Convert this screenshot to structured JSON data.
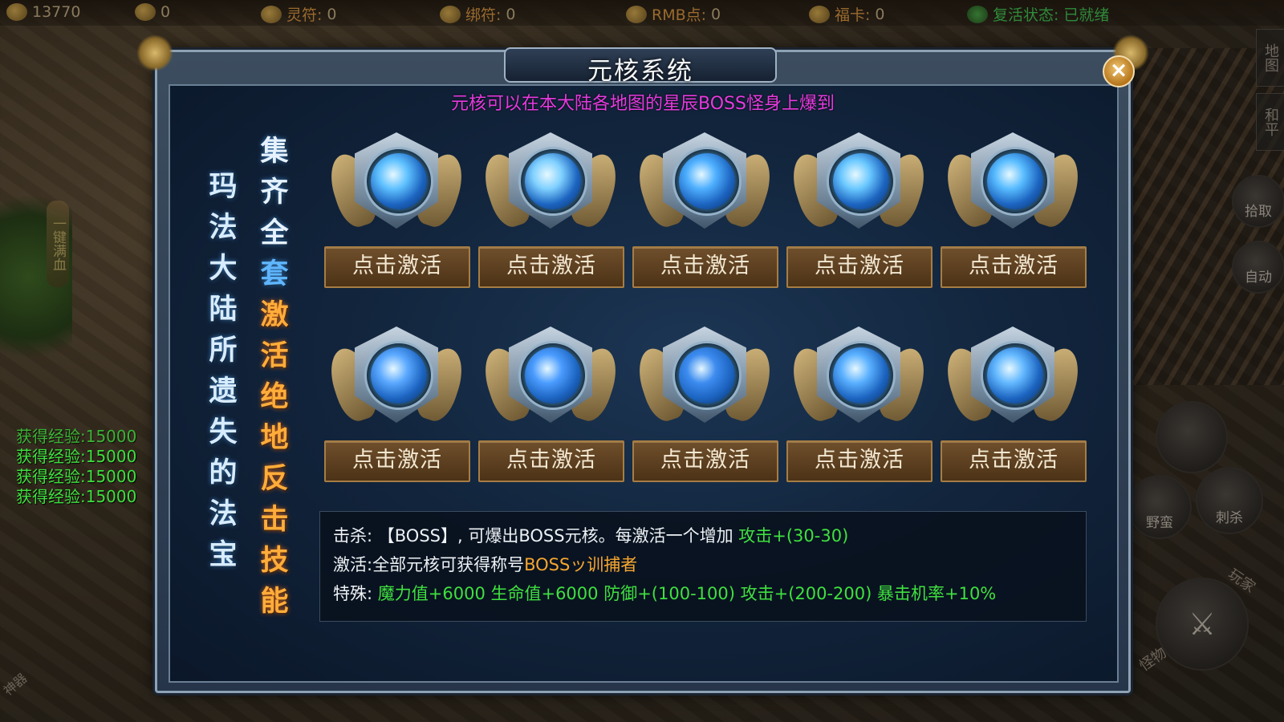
{
  "topbar": {
    "gold": {
      "value": "13770"
    },
    "yuanbao": {
      "value": "0"
    },
    "lingfu": {
      "label": "灵符:",
      "value": "0"
    },
    "bangfu": {
      "label": "绑符:",
      "value": "0"
    },
    "rmb": {
      "label": "RMB点:",
      "value": "0"
    },
    "fuka": {
      "label": "福卡:",
      "value": "0"
    },
    "revive": {
      "label": "复活状态:",
      "value": "已就绪"
    }
  },
  "side_tab": {
    "label": "一键满血"
  },
  "exp_log": [
    "获得经验:15000",
    "获得经验:15000",
    "获得经验:15000",
    "获得经验:15000"
  ],
  "right_panel": {
    "map": "地图",
    "peace": "和平",
    "pickup": "拾取",
    "auto": "自动",
    "skill_a": "野蛮",
    "skill_b": "刺杀",
    "skill_c": "玩家",
    "skill_d": "怪物"
  },
  "bottom_left_badge": "神器",
  "dialog": {
    "title": "元核系统",
    "subtitle": "元核可以在本大陆各地图的星辰BOSS怪身上爆到",
    "slogan_left": [
      "玛",
      "法",
      "大",
      "陆",
      "所",
      "遗",
      "失",
      "的",
      "法",
      "宝"
    ],
    "slogan_right": [
      "集",
      "齐",
      "全",
      "套",
      "激",
      "活",
      "绝",
      "地",
      "反",
      "击",
      "技",
      "能"
    ],
    "activate_label": "点击激活",
    "cores_count": 10,
    "info": {
      "kill_prefix": "击杀:",
      "kill_text": "【BOSS】, 可爆出BOSS元核。每激活一个增加",
      "kill_bonus": "攻击+(30-30)",
      "activate_prefix": "激活:",
      "activate_text": "全部元核可获得称号",
      "activate_title": "BOSSッ训捕者",
      "special_prefix": "特殊:",
      "special_stats": "魔力值+6000 生命值+6000 防御+(100-100) 攻击+(200-200) 暴击机率+10%"
    }
  },
  "colors": {
    "subtitle": "#e63adf",
    "bonus_green": "#3fe03f",
    "title_orange": "#f6a630",
    "button_brown": "#6f4f2c"
  }
}
